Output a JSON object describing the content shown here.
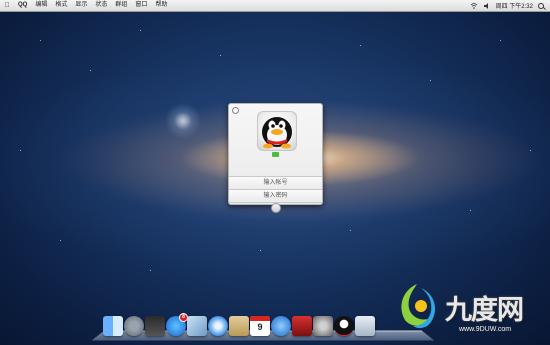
{
  "menubar": {
    "apple_icon": "apple-icon",
    "items": [
      "QQ",
      "编辑",
      "格式",
      "显示",
      "状态",
      "群组",
      "窗口",
      "帮助"
    ],
    "clock": "周四 下午2:32",
    "status_icons": [
      "wifi-icon",
      "volume-icon",
      "search-icon"
    ]
  },
  "login": {
    "account_placeholder": "输入帐号",
    "password_placeholder": "输入密码",
    "status_color": "#4cbe3b"
  },
  "dock": {
    "icons": [
      "finder-icon",
      "launchpad-icon",
      "mission-control-icon",
      "app-store-icon",
      "preview-icon",
      "safari-icon",
      "mail-icon",
      "calendar-icon",
      "itunes-icon",
      "photo-booth-icon",
      "system-preferences-icon",
      "qq-icon",
      "trash-icon"
    ],
    "app_store_badge": "8",
    "calendar_day": "9"
  },
  "watermark": {
    "text": "九度网",
    "url": "www.9DUW.com"
  },
  "colors": {
    "menubar": "#e6e6e6",
    "wallpaper_deep": "#0c1f42",
    "galaxy_core": "#ffe6c8",
    "accent_red": "#e02020"
  }
}
